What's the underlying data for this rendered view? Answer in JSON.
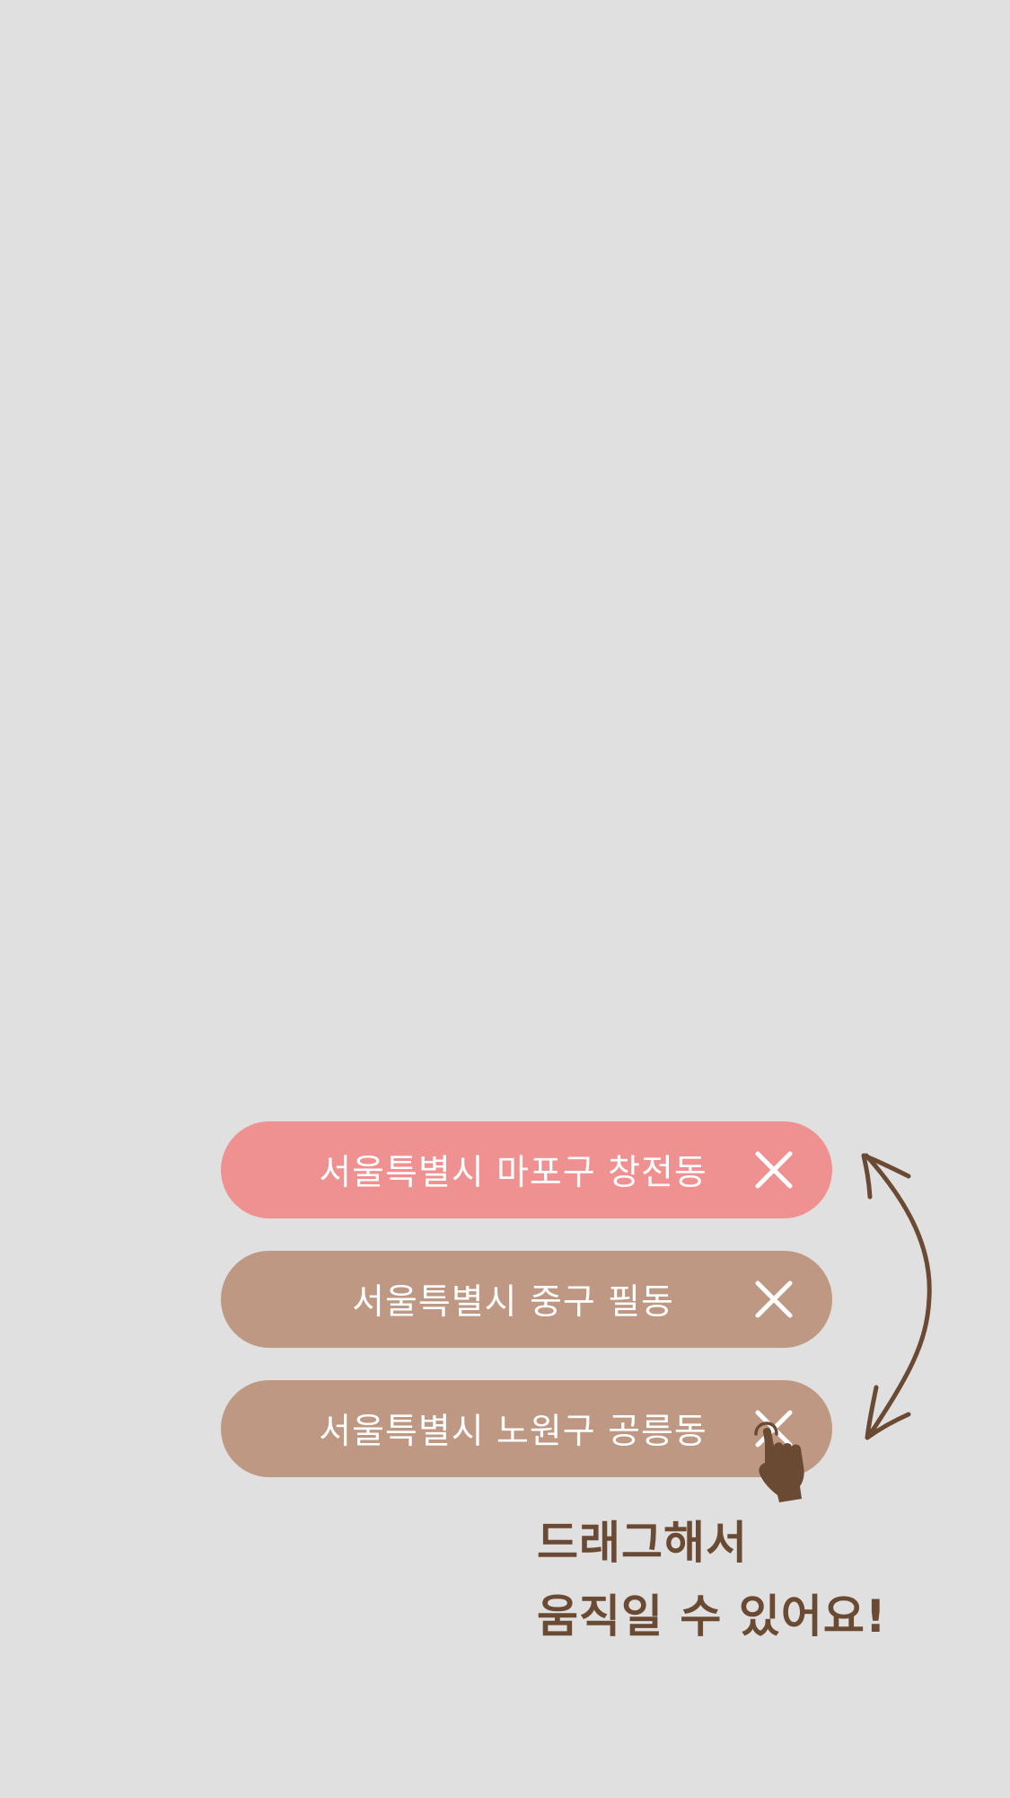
{
  "colors": {
    "background": "#e0e0e0",
    "active_pill": "#f09191",
    "inactive_pill": "#be9882",
    "accent_brown": "#6b4a33",
    "text_on_pill": "#ffffff"
  },
  "location_list": {
    "items": [
      {
        "label": "서울특별시 마포구 창전동",
        "state": "active",
        "close_icon": "close-icon"
      },
      {
        "label": "서울특별시 중구 필동",
        "state": "inactive",
        "close_icon": "close-icon"
      },
      {
        "label": "서울특별시 노원구 공릉동",
        "state": "inactive",
        "close_icon": "close-icon"
      }
    ]
  },
  "hint": {
    "line1": "드래그해서",
    "line2": "움직일 수 있어요!"
  },
  "icons": {
    "swap": "curved-double-arrow-icon",
    "cursor": "pointing-hand-icon"
  }
}
